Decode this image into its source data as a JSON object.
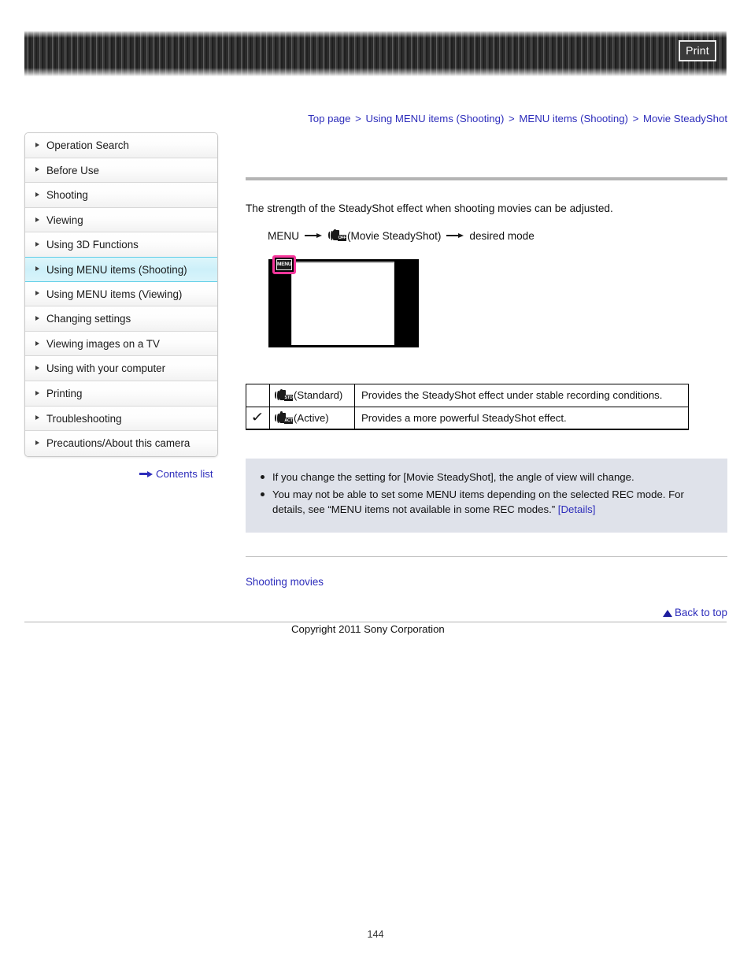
{
  "banner": {
    "print_label": "Print"
  },
  "breadcrumb": {
    "separator": ">",
    "items": [
      {
        "label": "Top page"
      },
      {
        "label": "Using MENU items (Shooting)"
      },
      {
        "label": "MENU items (Shooting)"
      },
      {
        "label": "Movie SteadyShot"
      }
    ]
  },
  "sidebar": {
    "items": [
      {
        "label": "Operation Search",
        "active": false
      },
      {
        "label": "Before Use",
        "active": false
      },
      {
        "label": "Shooting",
        "active": false
      },
      {
        "label": "Viewing",
        "active": false
      },
      {
        "label": "Using 3D Functions",
        "active": false
      },
      {
        "label": "Using MENU items (Shooting)",
        "active": true
      },
      {
        "label": "Using MENU items (Viewing)",
        "active": false
      },
      {
        "label": "Changing settings",
        "active": false
      },
      {
        "label": "Viewing images on a TV",
        "active": false
      },
      {
        "label": "Using with your computer",
        "active": false
      },
      {
        "label": "Printing",
        "active": false
      },
      {
        "label": "Troubleshooting",
        "active": false
      },
      {
        "label": "Precautions/About this camera",
        "active": false
      }
    ],
    "contents_list_label": "Contents list"
  },
  "main": {
    "intro": "The strength of the SteadyShot effect when shooting movies can be adjusted.",
    "menu_path": {
      "start": "MENU",
      "icon_tag": "OFF",
      "middle": "(Movie SteadyShot)",
      "end": "desired mode"
    },
    "figure": {
      "menu_button_label": "MENU"
    },
    "table": {
      "rows": [
        {
          "checked": "",
          "icon_tag": "STD",
          "mode": "(Standard)",
          "description": "Provides the SteadyShot effect under stable recording conditions."
        },
        {
          "checked": "✓",
          "icon_tag": "ACT",
          "mode": "(Active)",
          "description": "Provides a more powerful SteadyShot effect."
        }
      ]
    },
    "notes": [
      {
        "text": "If you change the setting for [Movie SteadyShot], the angle of view will change.",
        "link": ""
      },
      {
        "text": "You may not be able to set some MENU items depending on the selected REC mode. For details, see “MENU items not available in some REC modes.” ",
        "link": "[Details]"
      }
    ],
    "related_link": "Shooting movies"
  },
  "footer": {
    "back_to_top": "Back to top",
    "copyright": "Copyright 2011 Sony Corporation",
    "page_number": "144"
  }
}
